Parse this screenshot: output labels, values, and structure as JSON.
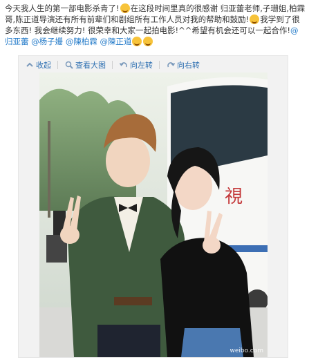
{
  "post": {
    "text_segments": [
      {
        "type": "text",
        "value": "今天我人生的第一部电影杀青了!"
      },
      {
        "type": "emoji",
        "name": "grin-icon"
      },
      {
        "type": "text",
        "value": "在这段时间里真的很感谢 归亚蕾老师,子珊姐,柏霖哥,陈正道导演还有所有前辈们和剧组所有工作人员对我的帮助和鼓励!"
      },
      {
        "type": "emoji",
        "name": "wink-icon"
      },
      {
        "type": "text",
        "value": "我学到了很多东西! 我会继续努力! 很荣幸和大家一起拍电影!^^希望有机会还可以一起合作!"
      },
      {
        "type": "mention",
        "value": "@归亚蕾"
      },
      {
        "type": "text",
        "value": " "
      },
      {
        "type": "mention",
        "value": "@杨子姗"
      },
      {
        "type": "text",
        "value": " "
      },
      {
        "type": "mention",
        "value": "@陳柏霖"
      },
      {
        "type": "text",
        "value": " "
      },
      {
        "type": "mention",
        "value": "@陳正道"
      },
      {
        "type": "emoji",
        "name": "laugh-icon"
      },
      {
        "type": "emoji",
        "name": "smile-icon"
      }
    ]
  },
  "toolbar": {
    "collapse": "收起",
    "view_large": "查看大图",
    "rotate_left": "向左转",
    "rotate_right": "向右转"
  },
  "photo": {
    "sign_text": "視",
    "watermark": "weibo.com"
  }
}
